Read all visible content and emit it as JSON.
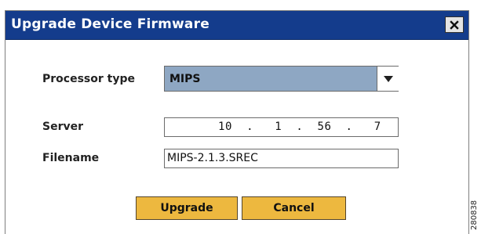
{
  "dialog": {
    "title": "Upgrade Device Firmware",
    "close_icon": "close-x-icon"
  },
  "form": {
    "processor_label": "Processor type",
    "processor_value": "MIPS",
    "dropdown_icon": "chevron-down-icon",
    "server_label": "Server",
    "server_ip": [
      "10",
      "1",
      "56",
      "7"
    ],
    "filename_label": "Filename",
    "filename_value": "MIPS-2.1.3.SREC"
  },
  "buttons": {
    "upgrade": "Upgrade",
    "cancel": "Cancel"
  },
  "figure_number": "280838",
  "colors": {
    "titlebar": "#143c8c",
    "select_background": "#8ea7c3",
    "button_background": "#edb83f"
  }
}
